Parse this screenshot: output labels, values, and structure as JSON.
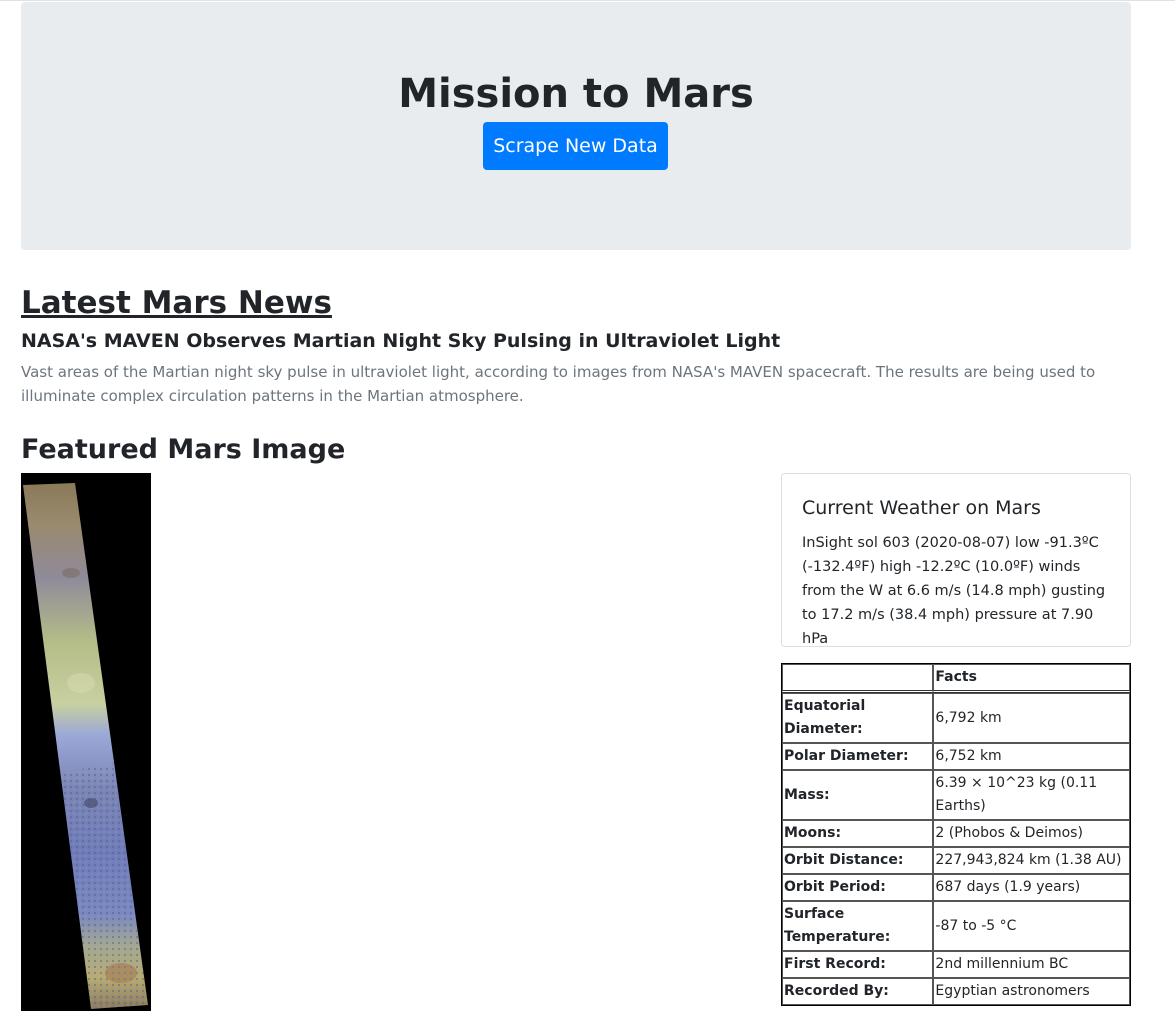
{
  "header": {
    "title": "Mission to Mars",
    "scrape_button_label": "Scrape New Data"
  },
  "news": {
    "section_heading": "Latest Mars News",
    "title": "NASA's MAVEN Observes Martian Night Sky Pulsing in Ultraviolet Light",
    "teaser": "Vast areas of the Martian night sky pulse in ultraviolet light, according to images from NASA's MAVEN spacecraft. The results are being used to illuminate complex circulation patterns in the Martian atmosphere."
  },
  "featured": {
    "section_heading": "Featured Mars Image"
  },
  "weather": {
    "title": "Current Weather on Mars",
    "text": "InSight sol 603 (2020-08-07) low -91.3ºC (-132.4ºF) high -12.2ºC (10.0ºF) winds from the W at 6.6 m/s (14.8 mph) gusting to 17.2 m/s (38.4 mph) pressure at 7.90 hPa"
  },
  "facts": {
    "header_blank": "",
    "header_label": "Facts",
    "rows": [
      {
        "label": "Equatorial Diameter:",
        "value": "6,792 km"
      },
      {
        "label": "Polar Diameter:",
        "value": "6,752 km"
      },
      {
        "label": "Mass:",
        "value": "6.39 × 10^23 kg (0.11 Earths)"
      },
      {
        "label": "Moons:",
        "value": "2 (Phobos & Deimos)"
      },
      {
        "label": "Orbit Distance:",
        "value": "227,943,824 km (1.38 AU)"
      },
      {
        "label": "Orbit Period:",
        "value": "687 days (1.9 years)"
      },
      {
        "label": "Surface Temperature:",
        "value": "-87 to -5 °C"
      },
      {
        "label": "First Record:",
        "value": "2nd millennium BC"
      },
      {
        "label": "Recorded By:",
        "value": "Egyptian astronomers"
      }
    ]
  },
  "colors": {
    "jumbotron_bg": "#e9ecef",
    "primary_button": "#007bff",
    "muted_text": "#6c757d"
  }
}
